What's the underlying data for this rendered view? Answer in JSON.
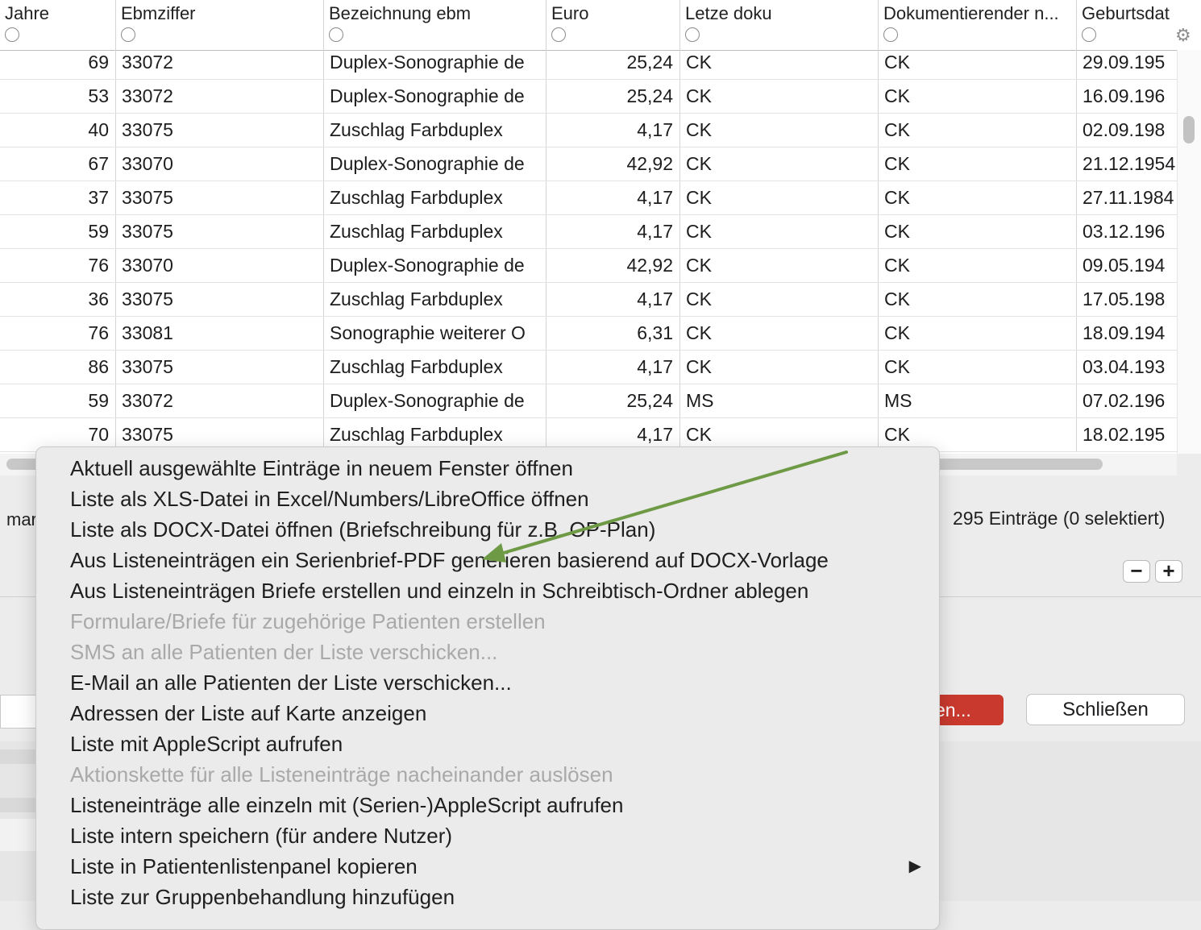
{
  "table": {
    "columns": [
      {
        "title": "Jahre"
      },
      {
        "title": "Ebmziffer"
      },
      {
        "title": "Bezeichnung ebm"
      },
      {
        "title": "Euro"
      },
      {
        "title": "Letze doku"
      },
      {
        "title": "Dokumentierender n..."
      },
      {
        "title": "Geburtsdat"
      }
    ],
    "rows": [
      {
        "jahre": "69",
        "ebm": "33072",
        "bez": "Duplex-Sonographie de",
        "euro": "25,24",
        "doku": "CK",
        "dok": "CK",
        "geb": "29.09.195"
      },
      {
        "jahre": "53",
        "ebm": "33072",
        "bez": "Duplex-Sonographie de",
        "euro": "25,24",
        "doku": "CK",
        "dok": "CK",
        "geb": "16.09.196"
      },
      {
        "jahre": "40",
        "ebm": "33075",
        "bez": "Zuschlag Farbduplex",
        "euro": "4,17",
        "doku": "CK",
        "dok": "CK",
        "geb": "02.09.198"
      },
      {
        "jahre": "67",
        "ebm": "33070",
        "bez": "Duplex-Sonographie de",
        "euro": "42,92",
        "doku": "CK",
        "dok": "CK",
        "geb": "21.12.1954"
      },
      {
        "jahre": "37",
        "ebm": "33075",
        "bez": "Zuschlag Farbduplex",
        "euro": "4,17",
        "doku": "CK",
        "dok": "CK",
        "geb": "27.11.1984"
      },
      {
        "jahre": "59",
        "ebm": "33075",
        "bez": "Zuschlag Farbduplex",
        "euro": "4,17",
        "doku": "CK",
        "dok": "CK",
        "geb": "03.12.196"
      },
      {
        "jahre": "76",
        "ebm": "33070",
        "bez": "Duplex-Sonographie de",
        "euro": "42,92",
        "doku": "CK",
        "dok": "CK",
        "geb": "09.05.194"
      },
      {
        "jahre": "36",
        "ebm": "33075",
        "bez": "Zuschlag Farbduplex",
        "euro": "4,17",
        "doku": "CK",
        "dok": "CK",
        "geb": "17.05.198"
      },
      {
        "jahre": "76",
        "ebm": "33081",
        "bez": "Sonographie weiterer O",
        "euro": "6,31",
        "doku": "CK",
        "dok": "CK",
        "geb": "18.09.194"
      },
      {
        "jahre": "86",
        "ebm": "33075",
        "bez": "Zuschlag Farbduplex",
        "euro": "4,17",
        "doku": "CK",
        "dok": "CK",
        "geb": "03.04.193"
      },
      {
        "jahre": "59",
        "ebm": "33072",
        "bez": "Duplex-Sonographie de",
        "euro": "25,24",
        "doku": "MS",
        "dok": "MS",
        "geb": "07.02.196"
      },
      {
        "jahre": "70",
        "ebm": "33075",
        "bez": "Zuschlag Farbduplex",
        "euro": "4,17",
        "doku": "CK",
        "dok": "CK",
        "geb": "18.02.195"
      }
    ]
  },
  "status": {
    "left_text": "mar",
    "count_text": "295 Einträge (0 selektiert)"
  },
  "buttons": {
    "minus": "−",
    "plus": "+",
    "red_label": "en...",
    "close_label": "Schließen"
  },
  "menu": {
    "items": [
      {
        "label": "Aktuell ausgewählte Einträge in neuem Fenster öffnen",
        "enabled": true
      },
      {
        "label": "Liste als XLS-Datei in Excel/Numbers/LibreOffice öffnen",
        "enabled": true
      },
      {
        "label": "Liste als DOCX-Datei öffnen (Briefschreibung für z.B. OP-Plan)",
        "enabled": true
      },
      {
        "label": "Aus Listeneinträgen ein Serienbrief-PDF generieren basierend auf DOCX-Vorlage",
        "enabled": true
      },
      {
        "label": "Aus Listeneinträgen Briefe erstellen und einzeln in Schreibtisch-Ordner ablegen",
        "enabled": true
      },
      {
        "label": "Formulare/Briefe für zugehörige Patienten erstellen",
        "enabled": false
      },
      {
        "label": "SMS an alle Patienten der Liste verschicken...",
        "enabled": false
      },
      {
        "label": "E-Mail an alle Patienten der Liste verschicken...",
        "enabled": true
      },
      {
        "label": "Adressen der Liste auf Karte anzeigen",
        "enabled": true
      },
      {
        "label": "Liste mit AppleScript aufrufen",
        "enabled": true
      },
      {
        "label": "Aktionskette für alle Listeneinträge nacheinander auslösen",
        "enabled": false
      },
      {
        "label": "Listeneinträge alle einzeln mit (Serien-)AppleScript aufrufen",
        "enabled": true
      },
      {
        "label": "Liste intern speichern (für andere Nutzer)",
        "enabled": true
      },
      {
        "label": "Liste in Patientenlistenpanel kopieren",
        "enabled": true,
        "submenu": true
      },
      {
        "label": "Liste zur Gruppenbehandlung hinzufügen",
        "enabled": true
      }
    ],
    "submenu_glyph": "▶"
  },
  "annotation": {
    "arrow_color": "#6e9a45"
  },
  "icons": {
    "gear": "gear-icon"
  }
}
